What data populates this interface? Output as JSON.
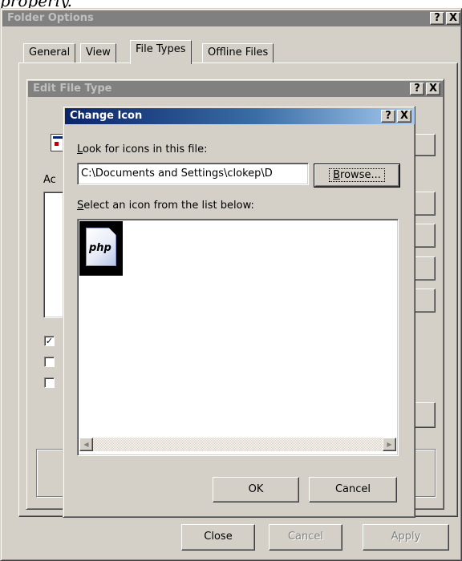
{
  "caption": {
    "text": "properly."
  },
  "folder_options": {
    "title": "Folder Options",
    "help_btn": "?",
    "close_btn": "X",
    "tabs": [
      {
        "label": "General"
      },
      {
        "label": "View"
      },
      {
        "label": "File Types",
        "selected": true
      },
      {
        "label": "Offline Files"
      }
    ],
    "buttons": {
      "close": "Close",
      "cancel": "Cancel",
      "apply": "Apply"
    }
  },
  "edit_file_type": {
    "title": "Edit File Type",
    "help_btn": "?",
    "close_btn": "X",
    "actions_label_visible": "Ac",
    "checkbox_checked": "✓"
  },
  "change_icon": {
    "title": "Change Icon",
    "help_btn": "?",
    "close_btn": "X",
    "look_for_label_first": "L",
    "look_for_label_rest": "ook for icons in this file:",
    "path_value": "C:\\Documents and Settings\\clokep\\D",
    "browse_first": "B",
    "browse_rest": "rowse...",
    "select_label_first": "S",
    "select_label_rest": "elect an icon from the list below:",
    "icons": [
      {
        "name": "php-icon",
        "label": "php",
        "selected": true
      }
    ],
    "ok": "OK",
    "cancel": "Cancel",
    "scroll_left": "◀",
    "scroll_right": "▶"
  }
}
